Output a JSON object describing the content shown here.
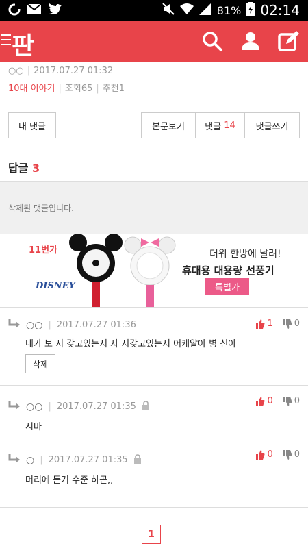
{
  "status_bar": {
    "battery": "81%",
    "time": "02:14",
    "left_icons": [
      "notification-icon",
      "mail-icon",
      "twitter-icon"
    ],
    "right_icons": [
      "mute-icon",
      "wifi-icon",
      "signal-icon",
      "battery-icon"
    ]
  },
  "app_bar": {
    "logo": "판",
    "color": "#e8444a",
    "icons": [
      "search-icon",
      "user-icon",
      "write-icon"
    ]
  },
  "post_meta": {
    "author": "○○",
    "datetime": "2017.07.27 01:32",
    "category": "10대 이야기",
    "views": "조회65",
    "recommends": "추천1"
  },
  "buttons": {
    "my_comments": "내 댓글",
    "view_post": "본문보기",
    "comments_label": "댓글",
    "comments_count": "14",
    "write_comment": "댓글쓰기"
  },
  "replies": {
    "heading": "답글",
    "count": "3",
    "deleted_text": "삭제된 댓글입니다."
  },
  "ad": {
    "badge": "11번가",
    "brand": "DISNEY",
    "line1": "더위 한방에 날려!",
    "line2": "휴대용 대용량 선풍기",
    "tag": "특별가"
  },
  "comments": [
    {
      "author": "○○",
      "datetime": "2017.07.27 01:36",
      "text": "내가 보 지 갖고있는지 자 지갖고있는지 어캐알아 병 신아",
      "likes": "1",
      "dislikes": "0",
      "delete_label": "삭제",
      "locked": false
    },
    {
      "author": "○○",
      "datetime": "2017.07.27 01:35",
      "text": "시바",
      "likes": "0",
      "dislikes": "0",
      "locked": true
    },
    {
      "author": "○",
      "datetime": "2017.07.27 01:35",
      "text": "머리에 든거 수준 하곤,,",
      "likes": "0",
      "dislikes": "0",
      "locked": true
    }
  ],
  "pagination": {
    "current": "1"
  }
}
